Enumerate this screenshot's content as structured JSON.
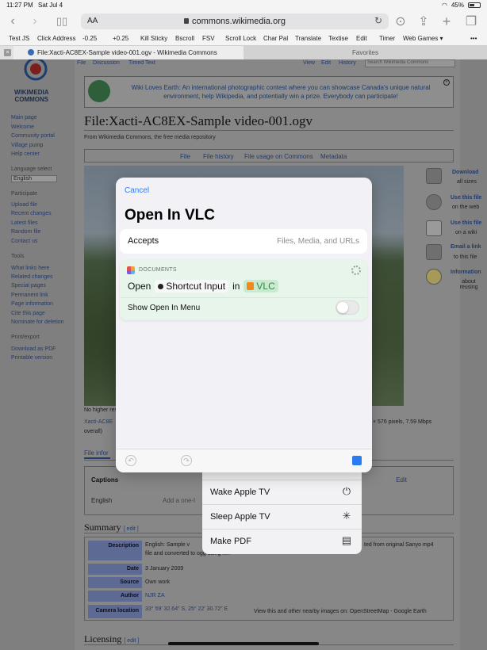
{
  "status": {
    "time": "11:27 PM",
    "date": "Sat Jul 4",
    "battery": "45%"
  },
  "safari": {
    "aa": "AA",
    "url": "commons.wikimedia.org",
    "bookmarks": [
      "Test JS",
      "Click Address",
      "-0.25",
      "+0.25",
      "Kill Sticky",
      "Bscroll",
      "FSV",
      "Scroll Lock",
      "Char Pal",
      "Translate",
      "Textise",
      "Edit",
      "Timer",
      "Web Games ▾"
    ],
    "tab_title": "File:Xacti-AC8EX-Sample video-001.ogv - Wikimedia Commons",
    "favorites_tab": "Favorites",
    "tab_close": "×"
  },
  "wiki": {
    "logo_text": "WIKIMEDIA\nCOMMONS",
    "tabs": {
      "file": "File",
      "discussion": "Discussion",
      "timed_text": "Timed Text",
      "view": "View",
      "edit": "Edit",
      "history": "History",
      "search_placeholder": "Search Wikimedia Commons"
    },
    "sidebar": {
      "nav": [
        "Main page",
        "Welcome",
        "Community portal",
        "Village pump",
        "Help center"
      ],
      "language_label": "Language select",
      "language_value": "English",
      "participate_h": "Participate",
      "participate": [
        "Upload file",
        "Recent changes",
        "Latest files",
        "Random file",
        "Contact us"
      ],
      "tools_h": "Tools",
      "tools": [
        "What links here",
        "Related changes",
        "Special pages",
        "Permanent link",
        "Page information",
        "Cite this page",
        "Nominate for deletion"
      ],
      "print_h": "Print/export",
      "print": [
        "Download as PDF",
        "Printable version"
      ]
    },
    "banner": "Wiki Loves Earth: An international photographic contest where you can showcase Canada's unique natural environment, help Wikipedia, and potentially win a prize. Everybody can participate!",
    "title": "File:Xacti-AC8EX-Sample video-001.ogv",
    "from": "From Wikimedia Commons, the free media repository",
    "file_tabs": [
      "File",
      "File history",
      "File usage on Commons",
      "Metadata"
    ],
    "under_photo_1": "No higher res",
    "under_photo_2": "Xacti-AC8E",
    "under_photo_3": "× 576 pixels, 7.59 Mbps",
    "under_photo_4": "overall)",
    "right_links": [
      {
        "bold": "Download",
        "rest": "all sizes"
      },
      {
        "bold": "Use this file",
        "rest": "on the web"
      },
      {
        "bold": "Use this file",
        "rest": "on a wiki"
      },
      {
        "bold": "Email a link",
        "rest": "to this file"
      },
      {
        "bold": "Information",
        "rest": "about reusing"
      }
    ],
    "file_info_tab": "File infor",
    "captions_h": "Captions",
    "captions_edit": "Edit",
    "captions_lang": "English",
    "captions_add": "Add a one-l",
    "summary_h": "Summary",
    "edit_link": "[ edit ]",
    "summary_rows": [
      {
        "label": "Description",
        "value": "English: Sample v",
        "value2": "ted from original Sanyo mp4",
        "value3": "file and converted to ogg using ffm"
      },
      {
        "label": "Date",
        "value": "3 January 2009"
      },
      {
        "label": "Source",
        "value": "Own work"
      },
      {
        "label": "Author",
        "value": "NJR ZA"
      },
      {
        "label": "Camera location",
        "value": "33° 59′ 32.64″ S, 25° 22′ 30.72″ E",
        "extra": "View this and other nearby images on: OpenStreetMap - Google Earth"
      }
    ],
    "licensing_h": "Licensing"
  },
  "behind_actions": [
    {
      "label": "Wake Apple TV",
      "icon": "power-icon"
    },
    {
      "label": "Sleep Apple TV",
      "icon": "sleep-icon"
    },
    {
      "label": "Make PDF",
      "icon": "document-icon"
    }
  ],
  "sheet": {
    "cancel": "Cancel",
    "title": "Open In VLC",
    "accepts_label": "Accepts",
    "accepts_value": "Files, Media, and URLs",
    "card_category": "DOCUMENTS",
    "open_word": "Open",
    "shortcut_input": "Shortcut Input",
    "in_word": "in",
    "app": "VLC",
    "show_in_menu": "Show Open In Menu",
    "show_in_menu_on": false
  },
  "colors": {
    "accent": "#2e7cf6",
    "card_bg": "#e7f5ea",
    "vlc_text": "#2e8a40"
  }
}
